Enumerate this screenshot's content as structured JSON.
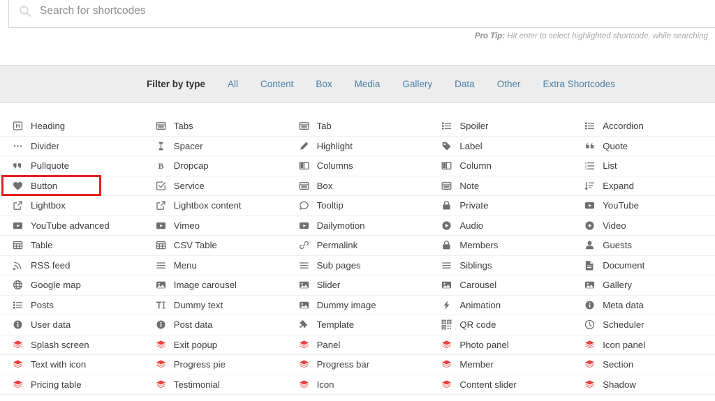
{
  "search": {
    "placeholder": "Search for shortcodes",
    "value": ""
  },
  "pro_tip": {
    "label": "Pro Tip:",
    "text": " Hit enter to select highlighted shortcode, while searching"
  },
  "filter": {
    "label": "Filter by type",
    "options": [
      "All",
      "Content",
      "Box",
      "Media",
      "Gallery",
      "Data",
      "Other",
      "Extra Shortcodes"
    ]
  },
  "colors": {
    "link": "#4a80a8",
    "red_icon": "#e8423f",
    "highlight_border": "#e02020",
    "filter_bar_bg": "#ededed",
    "text": "#3d3d3d"
  },
  "highlight": {
    "item": "Button"
  },
  "columns": [
    {
      "items": [
        {
          "label": "Heading",
          "icon": "heading-icon",
          "red": false
        },
        {
          "label": "Divider",
          "icon": "divider-icon",
          "red": false
        },
        {
          "label": "Pullquote",
          "icon": "quote-icon",
          "red": false
        },
        {
          "label": "Button",
          "icon": "heart-icon",
          "red": false
        },
        {
          "label": "Lightbox",
          "icon": "external-link-icon",
          "red": false
        },
        {
          "label": "YouTube advanced",
          "icon": "video-box-icon",
          "red": false
        },
        {
          "label": "Table",
          "icon": "table-grid-icon",
          "red": false
        },
        {
          "label": "RSS feed",
          "icon": "rss-icon",
          "red": false
        },
        {
          "label": "Google map",
          "icon": "globe-icon",
          "red": false
        },
        {
          "label": "Posts",
          "icon": "list-blocks-icon",
          "red": false
        },
        {
          "label": "User data",
          "icon": "info-circle-icon",
          "red": false
        },
        {
          "label": "Splash screen",
          "icon": "layers-icon",
          "red": true
        },
        {
          "label": "Text with icon",
          "icon": "layers-icon",
          "red": true
        },
        {
          "label": "Pricing table",
          "icon": "layers-icon",
          "red": true
        }
      ]
    },
    {
      "items": [
        {
          "label": "Tabs",
          "icon": "tabs-icon",
          "red": false
        },
        {
          "label": "Spacer",
          "icon": "vertical-arrow-icon",
          "red": false
        },
        {
          "label": "Dropcap",
          "icon": "bold-b-icon",
          "red": false
        },
        {
          "label": "Service",
          "icon": "check-square-icon",
          "red": false
        },
        {
          "label": "Lightbox content",
          "icon": "external-link-icon",
          "red": false
        },
        {
          "label": "Vimeo",
          "icon": "video-box-icon",
          "red": false
        },
        {
          "label": "CSV Table",
          "icon": "table-grid-icon",
          "red": false
        },
        {
          "label": "Menu",
          "icon": "menu-lines-icon",
          "red": false
        },
        {
          "label": "Image carousel",
          "icon": "image-icon",
          "red": false
        },
        {
          "label": "Dummy text",
          "icon": "text-tool-icon",
          "red": false
        },
        {
          "label": "Post data",
          "icon": "info-circle-icon",
          "red": false
        },
        {
          "label": "Exit popup",
          "icon": "layers-icon",
          "red": true
        },
        {
          "label": "Progress pie",
          "icon": "layers-icon",
          "red": true
        },
        {
          "label": "Testimonial",
          "icon": "layers-icon",
          "red": true
        }
      ]
    },
    {
      "items": [
        {
          "label": "Tab",
          "icon": "tabs-icon",
          "red": false
        },
        {
          "label": "Highlight",
          "icon": "pencil-icon",
          "red": false
        },
        {
          "label": "Columns",
          "icon": "columns-icon",
          "red": false
        },
        {
          "label": "Box",
          "icon": "tabs-icon",
          "red": false
        },
        {
          "label": "Tooltip",
          "icon": "speech-bubble-icon",
          "red": false
        },
        {
          "label": "Dailymotion",
          "icon": "video-box-icon",
          "red": false
        },
        {
          "label": "Permalink",
          "icon": "link-chain-icon",
          "red": false
        },
        {
          "label": "Sub pages",
          "icon": "menu-lines-icon",
          "red": false
        },
        {
          "label": "Slider",
          "icon": "image-icon",
          "red": false
        },
        {
          "label": "Dummy image",
          "icon": "image-icon",
          "red": false
        },
        {
          "label": "Template",
          "icon": "puzzle-icon",
          "red": false
        },
        {
          "label": "Panel",
          "icon": "layers-icon",
          "red": true
        },
        {
          "label": "Progress bar",
          "icon": "layers-icon",
          "red": true
        },
        {
          "label": "Icon",
          "icon": "layers-icon",
          "red": true
        }
      ]
    },
    {
      "items": [
        {
          "label": "Spoiler",
          "icon": "list-blocks-icon",
          "red": false
        },
        {
          "label": "Label",
          "icon": "tag-icon",
          "red": false
        },
        {
          "label": "Column",
          "icon": "columns-icon",
          "red": false
        },
        {
          "label": "Note",
          "icon": "tabs-icon",
          "red": false
        },
        {
          "label": "Private",
          "icon": "lock-icon",
          "red": false
        },
        {
          "label": "Audio",
          "icon": "play-circle-icon",
          "red": false
        },
        {
          "label": "Members",
          "icon": "lock-icon",
          "red": false
        },
        {
          "label": "Siblings",
          "icon": "menu-lines-icon",
          "red": false
        },
        {
          "label": "Carousel",
          "icon": "image-icon",
          "red": false
        },
        {
          "label": "Animation",
          "icon": "bolt-icon",
          "red": false
        },
        {
          "label": "QR code",
          "icon": "qr-code-icon",
          "red": false
        },
        {
          "label": "Photo panel",
          "icon": "layers-icon",
          "red": true
        },
        {
          "label": "Member",
          "icon": "layers-icon",
          "red": true
        },
        {
          "label": "Content slider",
          "icon": "layers-icon",
          "red": true
        }
      ]
    },
    {
      "items": [
        {
          "label": "Accordion",
          "icon": "list-blocks-icon",
          "red": false
        },
        {
          "label": "Quote",
          "icon": "quote-right-icon",
          "red": false
        },
        {
          "label": "List",
          "icon": "ordered-list-icon",
          "red": false
        },
        {
          "label": "Expand",
          "icon": "sort-amount-icon",
          "red": false
        },
        {
          "label": "YouTube",
          "icon": "video-box-icon",
          "red": false
        },
        {
          "label": "Video",
          "icon": "play-circle-icon",
          "red": false
        },
        {
          "label": "Guests",
          "icon": "user-icon",
          "red": false
        },
        {
          "label": "Document",
          "icon": "document-icon",
          "red": false
        },
        {
          "label": "Gallery",
          "icon": "image-icon",
          "red": false
        },
        {
          "label": "Meta data",
          "icon": "info-circle-icon",
          "red": false
        },
        {
          "label": "Scheduler",
          "icon": "clock-icon",
          "red": false
        },
        {
          "label": "Icon panel",
          "icon": "layers-icon",
          "red": true
        },
        {
          "label": "Section",
          "icon": "layers-icon",
          "red": true
        },
        {
          "label": "Shadow",
          "icon": "layers-icon",
          "red": true
        }
      ]
    }
  ]
}
